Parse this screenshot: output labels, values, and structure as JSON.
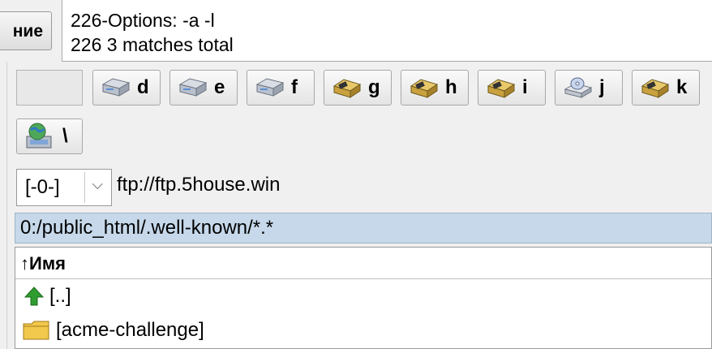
{
  "top_tab": {
    "label": "ние"
  },
  "log": {
    "line1": "226-Options: -a -l",
    "line2": "226 3 matches total"
  },
  "drives": [
    {
      "letter": "d",
      "icon": "hdd-icon"
    },
    {
      "letter": "e",
      "icon": "hdd-icon"
    },
    {
      "letter": "f",
      "icon": "hdd-icon"
    },
    {
      "letter": "g",
      "icon": "removable-drive-icon"
    },
    {
      "letter": "h",
      "icon": "removable-drive-icon"
    },
    {
      "letter": "i",
      "icon": "removable-drive-icon"
    },
    {
      "letter": "j",
      "icon": "cdrom-icon"
    },
    {
      "letter": "k",
      "icon": "removable-drive-icon"
    }
  ],
  "network": {
    "label": "\\",
    "icon": "network-globe-icon"
  },
  "connection": {
    "selected": "[-0-]",
    "host": "ftp://ftp.5house.win"
  },
  "path": "0:/public_html/.well-known/*.*",
  "list": {
    "header": "↑Имя",
    "rows": [
      {
        "name": "[..]",
        "icon": "up-arrow-icon"
      },
      {
        "name": "[acme-challenge]",
        "icon": "folder-icon"
      }
    ]
  },
  "colors": {
    "path_bar": "#c6d8ea",
    "folder": "#f2c94c",
    "up_arrow": "#2e9c2e"
  }
}
